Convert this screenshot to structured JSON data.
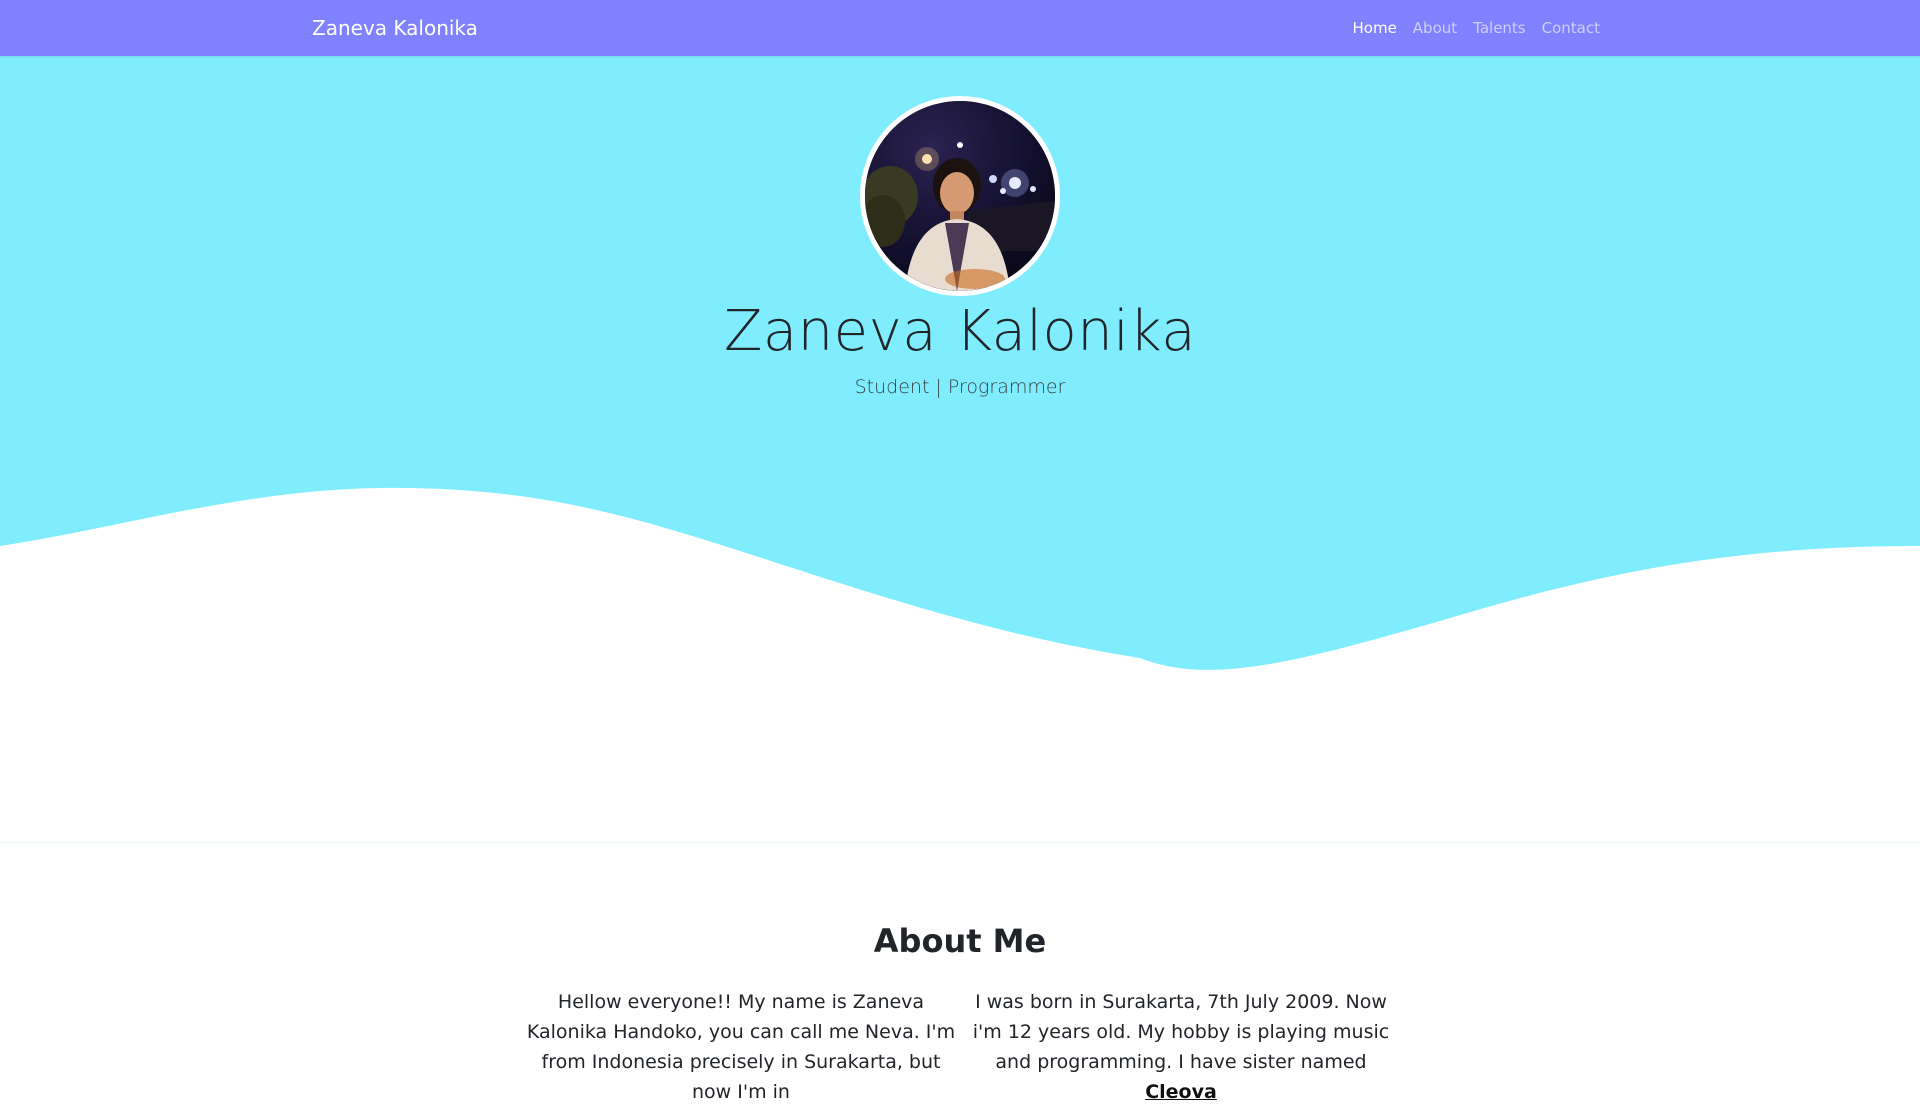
{
  "navbar": {
    "brand": "Zaneva Kalonika",
    "links": [
      {
        "label": "Home",
        "active": true
      },
      {
        "label": "About",
        "active": false
      },
      {
        "label": "Talents",
        "active": false
      },
      {
        "label": "Contact",
        "active": false
      }
    ]
  },
  "hero": {
    "name": "Zaneva Kalonika",
    "subtitle": "Student | Programmer"
  },
  "about": {
    "title": "About Me",
    "left_text": "Hellow everyone!! My name is Zaneva Kalonika Handoko, you can call me Neva. I'm from Indonesia precisely in Surakarta, but now I'm in",
    "right_text_prefix": "I was born in Surakarta, 7th July 2009. Now i'm 12 years old. My hobby is playing music and programming. I have sister named ",
    "sister_name": "Cleova"
  },
  "colors": {
    "navbar": "#7f81fe",
    "hero_bg": "#7fedfe",
    "text": "#212529"
  },
  "icons": {
    "avatar": "profile-photo"
  }
}
